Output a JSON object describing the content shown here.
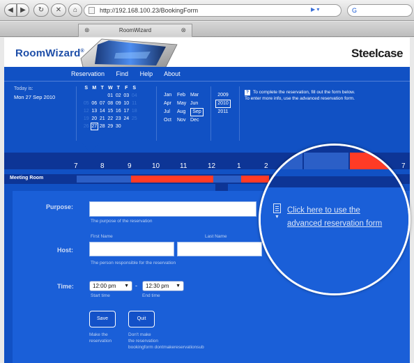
{
  "browser": {
    "url": "http://192.168.100.23/BookingForm",
    "search_placeholder": "G",
    "tab_title": "RoomWizard"
  },
  "brand": {
    "logo": "RoomWizard",
    "logo_mark": "®",
    "company": "Steelcase"
  },
  "menu": [
    "Reservation",
    "Find",
    "Help",
    "About"
  ],
  "today": {
    "label": "Today is:",
    "value": "Mon 27 Sep 2010"
  },
  "calendar": {
    "day_headers": [
      "S",
      "M",
      "T",
      "W",
      "T",
      "F",
      "S"
    ],
    "weeks": [
      [
        "",
        "",
        "",
        "01",
        "02",
        "03",
        "04"
      ],
      [
        "05",
        "06",
        "07",
        "08",
        "09",
        "10",
        "11"
      ],
      [
        "12",
        "13",
        "14",
        "15",
        "16",
        "17",
        "18"
      ],
      [
        "19",
        "20",
        "21",
        "22",
        "23",
        "24",
        "25"
      ],
      [
        "26",
        "27",
        "28",
        "29",
        "30",
        "",
        ""
      ]
    ],
    "selected_day": "27"
  },
  "months": [
    [
      "Jan",
      "Feb",
      "Mar"
    ],
    [
      "Apr",
      "May",
      "Jun"
    ],
    [
      "Jul",
      "Aug",
      "Sep"
    ],
    [
      "Oct",
      "Nov",
      "Dec"
    ]
  ],
  "selected_month": "Sep",
  "years": [
    "2009",
    "2010",
    "2011"
  ],
  "selected_year": "2010",
  "help_text": {
    "line1": "To complete the reservation, fill out the form below.",
    "line2": "To enter more info, use the advanced reservation form."
  },
  "timeline": {
    "hours": [
      "7",
      "8",
      "9",
      "10",
      "11",
      "12",
      "1",
      "2",
      "7"
    ],
    "room_label": "Meeting Room"
  },
  "form": {
    "purpose_label": "Purpose:",
    "purpose_hint": "The purpose of the reservation",
    "host_label": "Host:",
    "first_name_label": "First Name",
    "last_name_label": "Last Name",
    "host_hint": "The person responsible for the reservation",
    "time_label": "Time:",
    "start_time": "12:00 pm",
    "end_time": "12:30 pm",
    "start_hint": "Start time",
    "end_hint": "End time",
    "separator": "-",
    "save_label": "Save",
    "save_hint_1": "Make the",
    "save_hint_2": "reservation",
    "quit_label": "Quit",
    "quit_hint_1": "Don't make",
    "quit_hint_2": "the reservation",
    "quit_hint_3": "bookingform dontmakereservationsub"
  },
  "advanced_link": {
    "line1": "Click here to use the",
    "line2": "advanced reservation form"
  },
  "colors": {
    "page_blue": "#1151c4",
    "dark_blue": "#0d3596",
    "busy_red": "#ff3b26"
  }
}
